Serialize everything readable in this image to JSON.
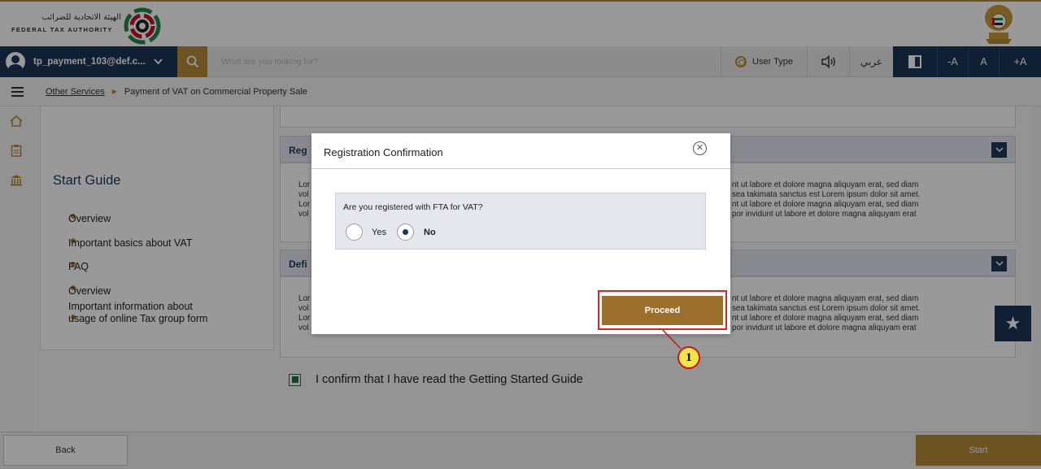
{
  "header": {
    "logo_arabic": "الهيئة الاتحادية للضرائب",
    "logo_english": "FEDERAL TAX AUTHORITY"
  },
  "navbar": {
    "user_email": "tp_payment_103@def.c...",
    "search_placeholder": "What are you looking for?",
    "user_type_label": "User Type",
    "language_label": "عربي",
    "font_decrease": "-A",
    "font_normal": "A",
    "font_increase": "+A"
  },
  "breadcrumb": {
    "parent": "Other Services",
    "current": "Payment of VAT on Commercial Property Sale"
  },
  "guide": {
    "title": "Start Guide",
    "items": [
      "Overview",
      "Important basics about VAT",
      "FAQ",
      "Overview",
      "Important information about",
      "usage of online Tax group form"
    ]
  },
  "sections": [
    {
      "title": "Reg",
      "left_lines": [
        "Lor",
        "vol",
        "Lor",
        "vol"
      ],
      "right_lines": [
        "nt ut labore et dolore magna aliquyam erat, sed diam",
        "sea takimata sanctus est Lorem ipsum dolor sit amet.",
        "nt ut labore et dolore magna aliquyam erat, sed diam",
        "por invidunt ut labore et dolore magna aliquyam erat"
      ]
    },
    {
      "title": "Defi",
      "left_lines": [
        "Lor",
        "vol",
        "Lor",
        "vol"
      ],
      "right_lines": [
        "nt ut labore et dolore magna aliquyam erat, sed diam",
        "sea takimata sanctus est Lorem ipsum dolor sit amet.",
        "nt ut labore et dolore magna aliquyam erat, sed diam",
        "por invidunt ut labore et dolore magna aliquyam erat"
      ]
    }
  ],
  "confirm": {
    "text": "I confirm that I have read the Getting Started Guide",
    "checked": true
  },
  "footer": {
    "back_label": "Back",
    "start_label": "Start"
  },
  "modal": {
    "title": "Registration Confirmation",
    "question": "Are you registered with FTA for VAT?",
    "option_yes": "Yes",
    "option_no": "No",
    "selected": "No",
    "proceed_label": "Proceed"
  },
  "annotation": {
    "callout_number": "1",
    "highlight_color": "#e02424",
    "badge_color": "#f7e44a"
  },
  "colors": {
    "brand_gold": "#b58b3a",
    "navy": "#1d3557",
    "proceed": "#9c6f2c"
  },
  "icons": {
    "user": "user-avatar-icon",
    "search": "search-icon",
    "settings": "gear-icon",
    "speaker": "speaker-icon",
    "contrast": "contrast-icon",
    "menu": "hamburger-icon",
    "home": "home-icon",
    "clipboard": "clipboard-icon",
    "bank": "bank-icon",
    "star": "star-icon",
    "close": "close-icon",
    "chevron": "chevron-down-icon"
  }
}
